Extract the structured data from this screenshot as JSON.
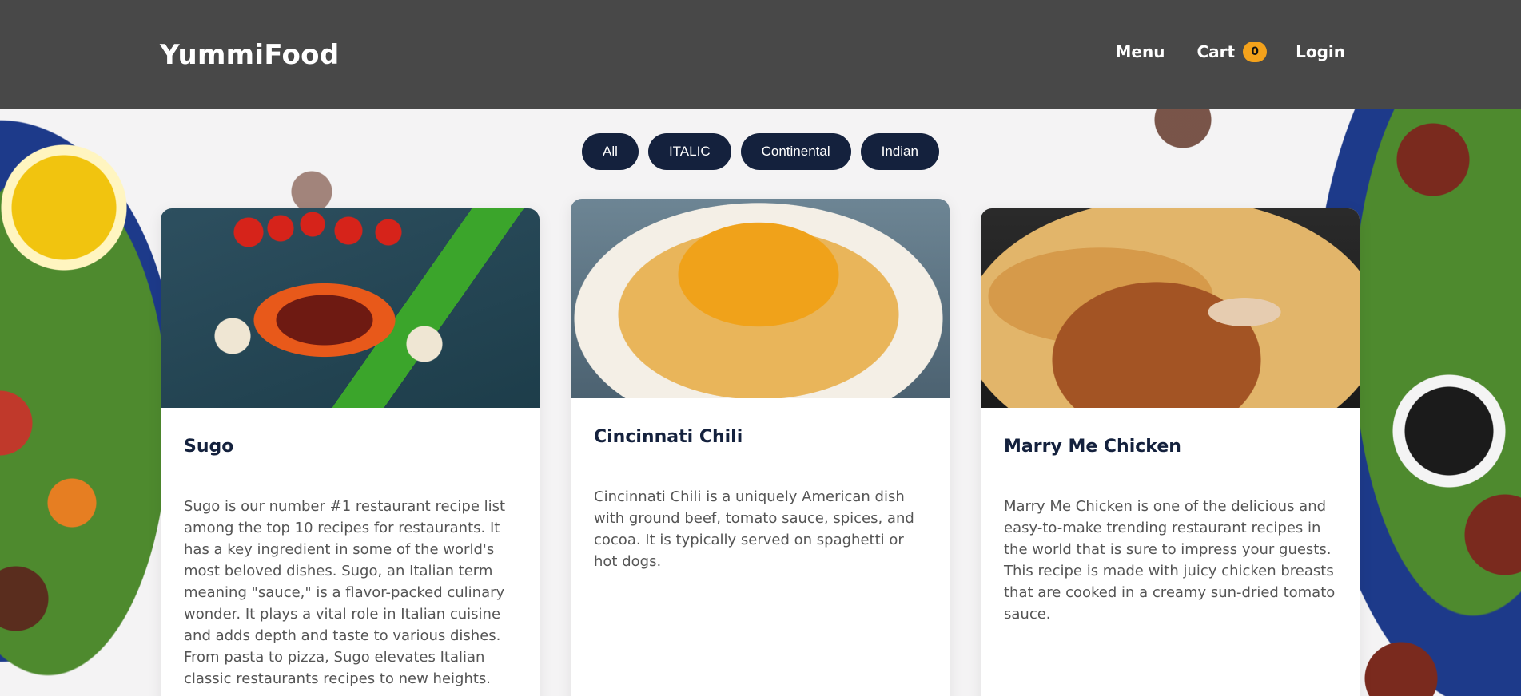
{
  "header": {
    "brand": "YummiFood",
    "nav": {
      "menu": "Menu",
      "cart": "Cart",
      "cart_count": "0",
      "login": "Login"
    }
  },
  "filters": [
    "All",
    "ITALIC",
    "Continental",
    "Indian"
  ],
  "cards": [
    {
      "title": "Sugo",
      "description": "Sugo is our number #1 restaurant recipe list among the top 10 recipes for restaurants. It has a key ingredient in some of the world's most beloved dishes. Sugo, an Italian term meaning \"sauce,\" is a flavor-packed culinary wonder. It plays a vital role in Italian cuisine and adds depth and taste to various dishes. From pasta to pizza, Sugo elevates Italian classic restaurants recipes to new heights."
    },
    {
      "title": "Cincinnati Chili",
      "description": "Cincinnati Chili is a uniquely American dish with ground beef, tomato sauce, spices, and cocoa. It is typically served on spaghetti or hot dogs."
    },
    {
      "title": "Marry Me Chicken",
      "description": "Marry Me Chicken is one of the delicious and easy-to-make trending restaurant recipes in the world that is sure to impress your guests. This recipe is made with juicy chicken breasts that are cooked in a creamy sun-dried tomato sauce."
    }
  ],
  "colors": {
    "header_bg": "#484848",
    "accent_badge": "#f4a21b",
    "filter_bg": "#14213d",
    "title_color": "#14213d"
  }
}
